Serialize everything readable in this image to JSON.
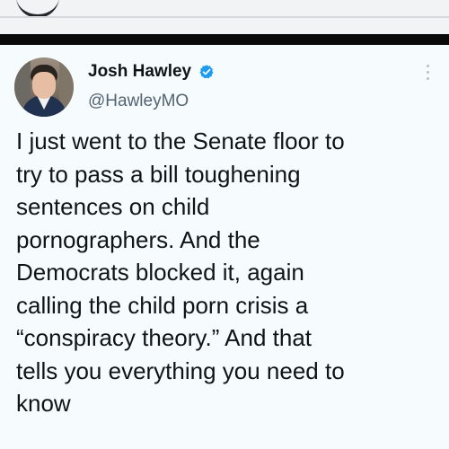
{
  "post": {
    "author_name": "Josh Hawley",
    "author_handle": "@HawleyMO",
    "verified_icon": "verified-badge-icon",
    "more_icon": "more-options-icon",
    "avatar_icon": "profile-avatar",
    "text": "I just went to the Senate floor to\ntry to pass a bill toughening\nsentences on child\npornographers. And the\nDemocrats blocked it, again\ncalling the child porn crisis a\n“conspiracy theory.” And that\ntells you everything you need to\nknow"
  },
  "colors": {
    "background": "#f6fbfd",
    "text": "#0f1419",
    "secondary_text": "#536471",
    "verified_blue": "#1d9bf0",
    "black_band": "#0a0a0a"
  }
}
